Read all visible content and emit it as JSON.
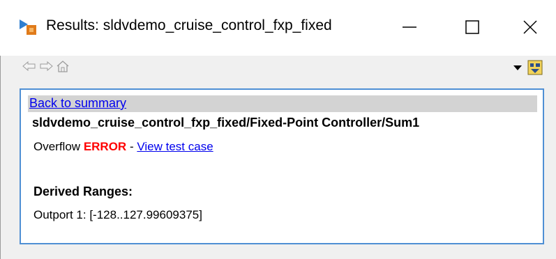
{
  "window": {
    "title": "Results: sldvdemo_cruise_control_fxp_fixed",
    "icon": "simulink-results-icon",
    "controls": {
      "minimize": "minimize-icon",
      "maximize": "maximize-icon",
      "close": "close-icon"
    }
  },
  "toolbar": {
    "back_icon": "back-arrow-icon",
    "forward_icon": "forward-arrow-icon",
    "home_icon": "home-icon",
    "menu_icon": "chevron-down-icon",
    "action_icon": "highlight-model-icon"
  },
  "results": {
    "back_link": "Back to summary",
    "block_path": "sldvdemo_cruise_control_fxp_fixed/Fixed-Point Controller/Sum1",
    "objective_type": "Overflow",
    "status": "ERROR",
    "separator": "-",
    "view_link": "View test case",
    "ranges_heading": "Derived Ranges:",
    "ranges_value": "Outport 1: [-128..127.99609375]"
  },
  "colors": {
    "link": "#0000ee",
    "error": "#ff0000",
    "pane_border": "#4f8fd4",
    "summary_bar": "#d3d3d3"
  }
}
